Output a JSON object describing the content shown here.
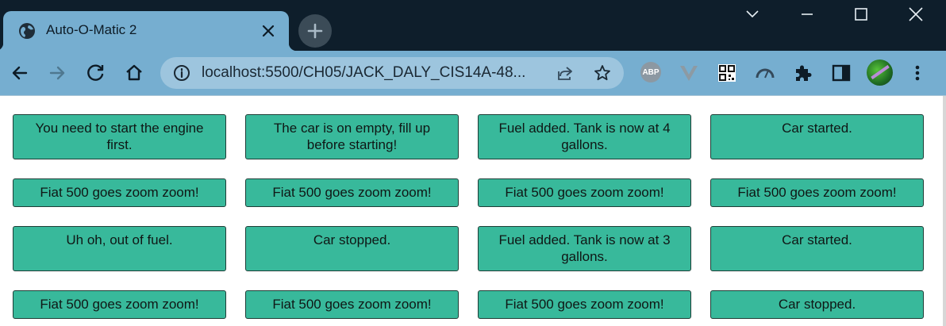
{
  "browser": {
    "tab": {
      "title": "Auto-O-Matic 2",
      "favicon": "globe-icon",
      "close": "close-icon"
    },
    "new_tab": "plus-icon",
    "window_controls": [
      "chevron-down-icon",
      "minimize-icon",
      "maximize-icon",
      "close-icon"
    ],
    "toolbar": {
      "back": "back-arrow-icon",
      "forward": "forward-arrow-icon",
      "reload": "reload-icon",
      "home": "home-icon",
      "url": "localhost:5500/CH05/JACK_DALY_CIS14A-48...",
      "extensions": [
        "adblock-plus-icon",
        "vimium-icon",
        "qr-code-icon",
        "speedometer-icon",
        "puzzle-icon",
        "side-panel-icon"
      ],
      "abp_label": "ABP",
      "menu": "kebab-menu-icon"
    },
    "colors": {
      "titlebar": "#0e1e2b",
      "toolbar": "#76aed0",
      "cell_bg": "#38b99b",
      "cell_border": "#1e3d36"
    }
  },
  "messages": [
    [
      "You need to start the engine first.",
      "The car is on empty, fill up before starting!",
      "Fuel added. Tank is now at 4 gallons.",
      "Car started."
    ],
    [
      "Fiat 500 goes zoom zoom!",
      "Fiat 500 goes zoom zoom!",
      "Fiat 500 goes zoom zoom!",
      "Fiat 500 goes zoom zoom!"
    ],
    [
      "Uh oh, out of fuel.",
      "Car stopped.",
      "Fuel added. Tank is now at 3 gallons.",
      "Car started."
    ],
    [
      "Fiat 500 goes zoom zoom!",
      "Fiat 500 goes zoom zoom!",
      "Fiat 500 goes zoom zoom!",
      "Car stopped."
    ]
  ]
}
